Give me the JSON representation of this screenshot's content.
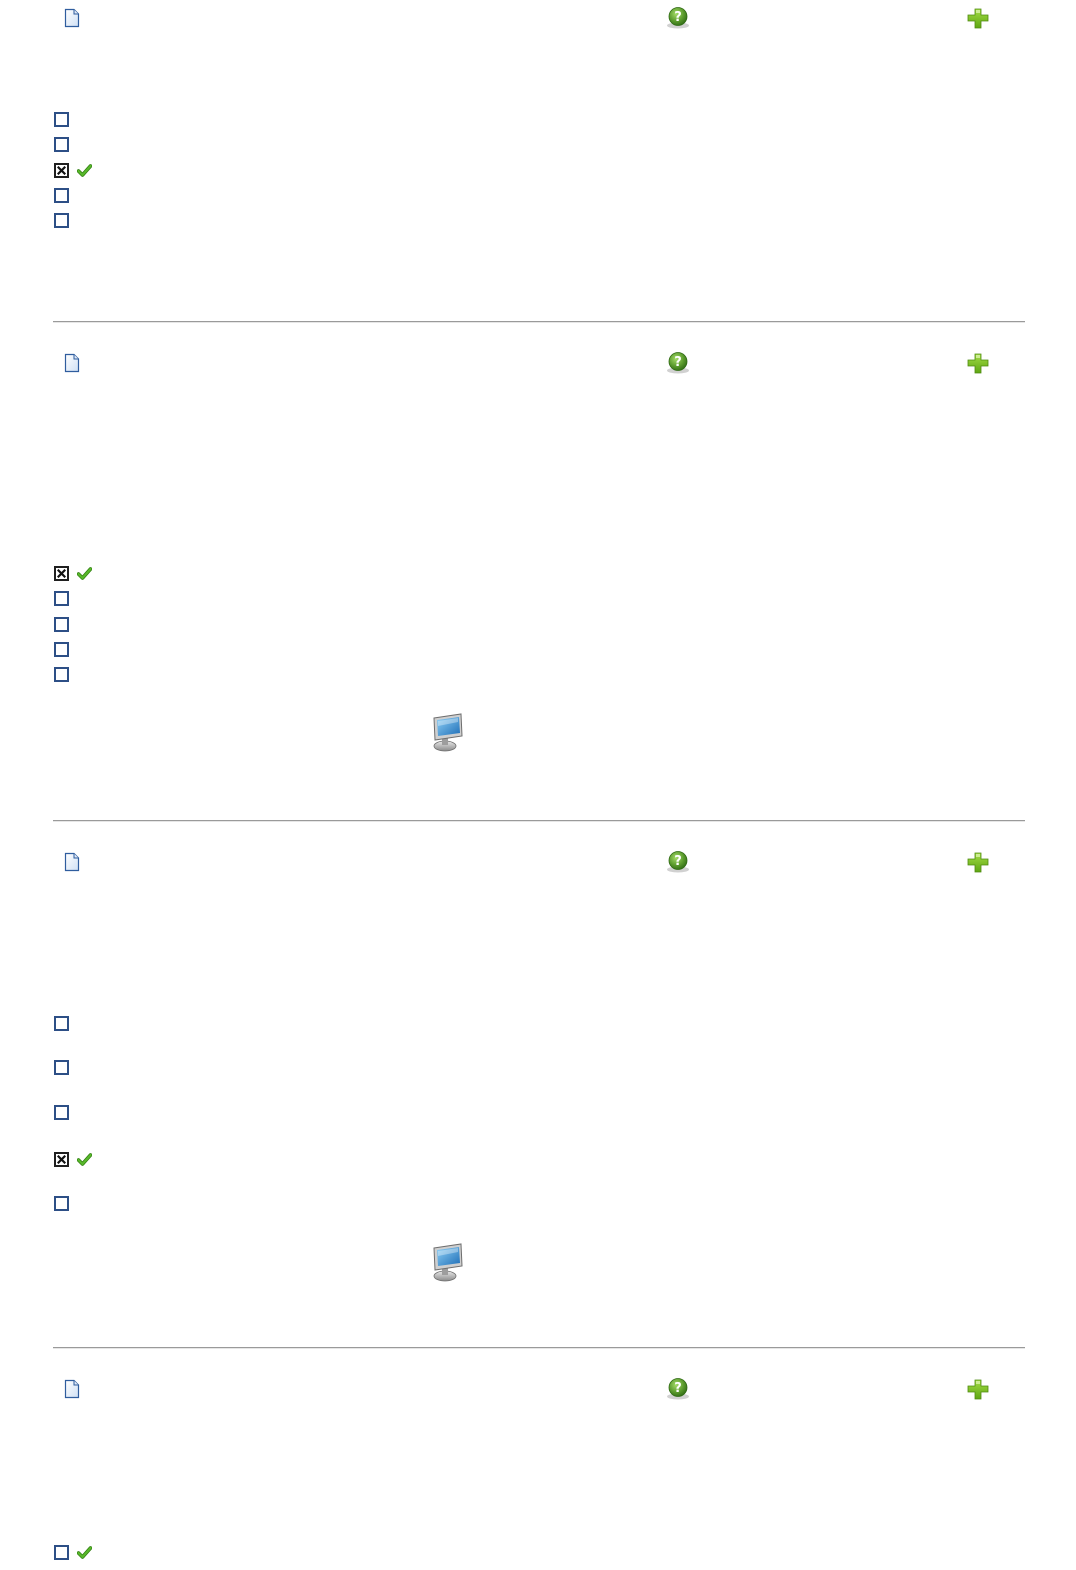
{
  "sections": [
    {
      "document_icon": "document-icon",
      "help_icon": "help-icon",
      "add_icon": "add-icon",
      "answers": [
        {
          "checked": false,
          "correct": false
        },
        {
          "checked": false,
          "correct": false
        },
        {
          "checked": true,
          "correct": true
        },
        {
          "checked": false,
          "correct": false
        },
        {
          "checked": false,
          "correct": false
        }
      ],
      "media_icon": ""
    },
    {
      "document_icon": "document-icon",
      "help_icon": "help-icon",
      "add_icon": "add-icon",
      "answers": [
        {
          "checked": true,
          "correct": true
        },
        {
          "checked": false,
          "correct": false
        },
        {
          "checked": false,
          "correct": false
        },
        {
          "checked": false,
          "correct": false
        },
        {
          "checked": false,
          "correct": false
        }
      ],
      "media_icon": "monitor-icon"
    },
    {
      "document_icon": "document-icon",
      "help_icon": "help-icon",
      "add_icon": "add-icon",
      "answers": [
        {
          "checked": false,
          "correct": false
        },
        {
          "checked": false,
          "correct": false
        },
        {
          "checked": false,
          "correct": false
        },
        {
          "checked": true,
          "correct": true
        },
        {
          "checked": false,
          "correct": false
        }
      ],
      "media_icon": "monitor-icon"
    },
    {
      "document_icon": "document-icon",
      "help_icon": "help-icon",
      "add_icon": "add-icon",
      "answers": [
        {
          "checked": false,
          "correct": true
        }
      ],
      "media_icon": ""
    }
  ],
  "colors": {
    "checkbox_border": "#2d4f86",
    "tick_green": "#58b82a",
    "help_green": "#5a9a2c",
    "plus_green": "#7ac11f",
    "divider": "#9a9a9a"
  }
}
